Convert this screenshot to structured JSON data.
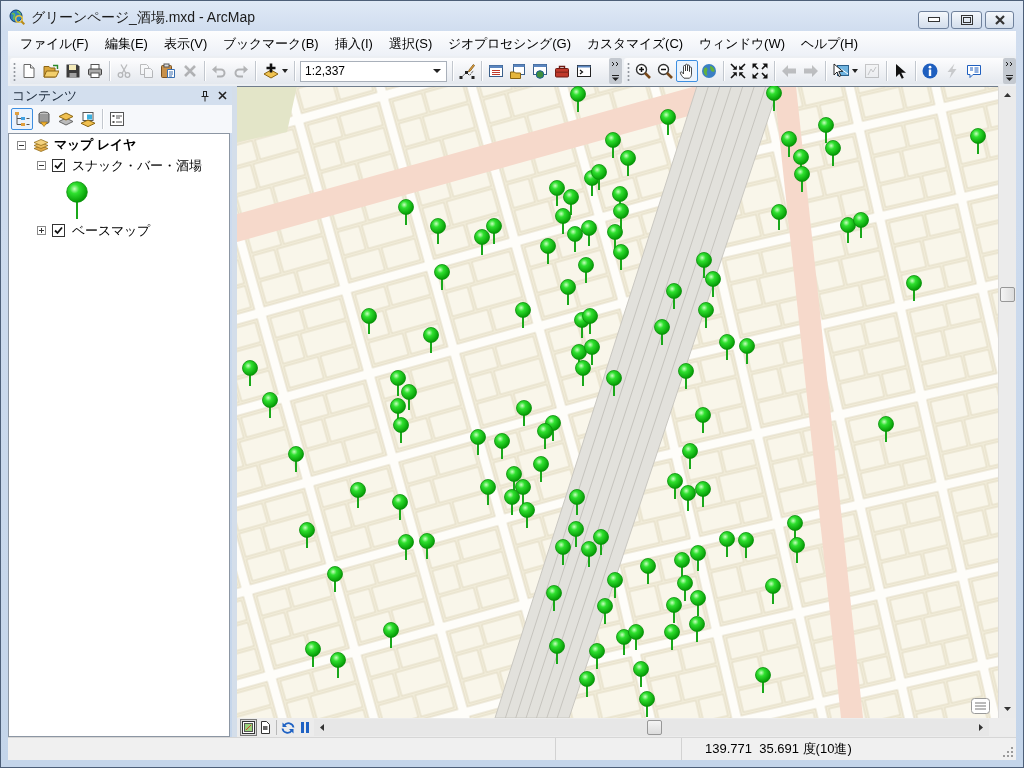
{
  "window": {
    "title": "グリーンページ_酒場.mxd - ArcMap"
  },
  "menu": [
    "ファイル(F)",
    "編集(E)",
    "表示(V)",
    "ブックマーク(B)",
    "挿入(I)",
    "選択(S)",
    "ジオプロセシング(G)",
    "カスタマイズ(C)",
    "ウィンドウ(W)",
    "ヘルプ(H)"
  ],
  "toolbars": [
    {
      "groups": [
        [
          {
            "kind": "new",
            "selected": false,
            "disabled": false
          },
          {
            "kind": "open",
            "selected": false,
            "disabled": false
          },
          {
            "kind": "save",
            "selected": false,
            "disabled": false
          },
          {
            "kind": "print",
            "selected": false,
            "disabled": false
          }
        ],
        [
          {
            "kind": "cut",
            "selected": false,
            "disabled": true
          },
          {
            "kind": "copy",
            "selected": false,
            "disabled": true
          },
          {
            "kind": "paste",
            "selected": false,
            "disabled": false
          },
          {
            "kind": "delete",
            "selected": false,
            "disabled": true
          }
        ],
        [
          {
            "kind": "undo",
            "selected": false,
            "disabled": true
          },
          {
            "kind": "redo",
            "selected": false,
            "disabled": true
          }
        ],
        [
          {
            "kind": "add_data",
            "selected": false,
            "disabled": false,
            "dropdown": true
          }
        ],
        [
          {
            "kind": "scale",
            "value": "1:2,337"
          }
        ],
        [
          {
            "kind": "editor",
            "selected": false,
            "disabled": false
          }
        ],
        [
          {
            "kind": "list_window",
            "selected": false,
            "disabled": false
          },
          {
            "kind": "folder_window",
            "selected": false,
            "disabled": false
          },
          {
            "kind": "globe_window",
            "selected": false,
            "disabled": false
          },
          {
            "kind": "toolbox",
            "selected": false,
            "disabled": false
          },
          {
            "kind": "terminal",
            "selected": false,
            "disabled": false
          }
        ]
      ]
    },
    {
      "groups": [
        [
          {
            "kind": "zoom_in",
            "selected": false,
            "disabled": false
          },
          {
            "kind": "zoom_out",
            "selected": false,
            "disabled": false
          },
          {
            "kind": "pan",
            "selected": true,
            "disabled": false
          },
          {
            "kind": "full_extent",
            "selected": false,
            "disabled": false
          }
        ],
        [
          {
            "kind": "fixed_zoom_in",
            "selected": false,
            "disabled": false
          },
          {
            "kind": "fixed_zoom_out",
            "selected": false,
            "disabled": false
          }
        ],
        [
          {
            "kind": "back",
            "selected": false,
            "disabled": true
          },
          {
            "kind": "forward",
            "selected": false,
            "disabled": true
          }
        ],
        [
          {
            "kind": "select_features",
            "selected": false,
            "disabled": false,
            "dropdown": true
          },
          {
            "kind": "clear_selection",
            "selected": false,
            "disabled": true
          }
        ],
        [
          {
            "kind": "select_elements",
            "selected": false,
            "disabled": false
          }
        ],
        [
          {
            "kind": "identify",
            "selected": false,
            "disabled": false
          },
          {
            "kind": "hyperlink",
            "selected": false,
            "disabled": true
          },
          {
            "kind": "html_popup",
            "selected": false,
            "disabled": false
          }
        ]
      ]
    }
  ],
  "contents": {
    "title": "コンテンツ",
    "list_buttons": [
      {
        "kind": "drawing_order",
        "selected": true
      },
      {
        "kind": "source",
        "selected": false
      },
      {
        "kind": "visibility",
        "selected": false
      },
      {
        "kind": "selection",
        "selected": false
      }
    ],
    "tree": [
      {
        "kind": "data_frame",
        "label": "マップ レイヤ",
        "expanded": true,
        "children": [
          {
            "kind": "layer",
            "label": "スナック・バー・酒場",
            "checked": true,
            "expanded": true,
            "children": [
              {
                "kind": "point_symbol"
              }
            ]
          },
          {
            "kind": "layer",
            "label": "ベースマップ",
            "checked": true,
            "expanded": false
          }
        ]
      }
    ]
  },
  "map_view_bar": {
    "views": [
      {
        "kind": "data_view",
        "selected": true
      },
      {
        "kind": "layout_view",
        "selected": false
      }
    ]
  },
  "status_bar": {
    "coordinates": "139.771  35.691 度(10進)"
  }
}
